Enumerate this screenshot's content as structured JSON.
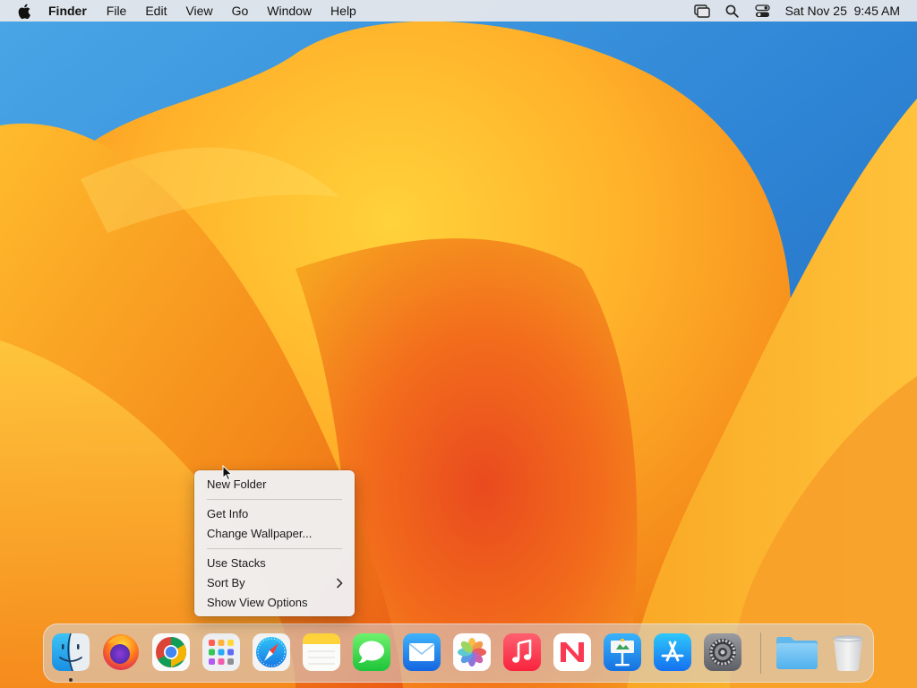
{
  "menubar": {
    "apple_icon": "apple-logo-icon",
    "app_name": "Finder",
    "menus": [
      "File",
      "Edit",
      "View",
      "Go",
      "Window",
      "Help"
    ],
    "status_icons": [
      "screen-mirroring-icon",
      "spotlight-search-icon",
      "control-center-icon"
    ],
    "clock": "Sat Nov 25  9:45 AM"
  },
  "context_menu": {
    "group1": [
      "New Folder"
    ],
    "group2": [
      "Get Info",
      "Change Wallpaper..."
    ],
    "group3": [
      "Use Stacks",
      "Sort By",
      "Show View Options"
    ],
    "submenu_icon": "chevron-right-icon"
  },
  "dock": {
    "apps": [
      {
        "name": "Finder",
        "icon": "finder-icon",
        "running": true
      },
      {
        "name": "Firefox",
        "icon": "firefox-icon"
      },
      {
        "name": "Google Chrome",
        "icon": "chrome-icon"
      },
      {
        "name": "Launchpad",
        "icon": "launchpad-icon"
      },
      {
        "name": "Safari",
        "icon": "safari-icon"
      },
      {
        "name": "Notes",
        "icon": "notes-icon"
      },
      {
        "name": "Messages",
        "icon": "messages-icon"
      },
      {
        "name": "Mail",
        "icon": "mail-icon"
      },
      {
        "name": "Photos",
        "icon": "photos-icon"
      },
      {
        "name": "Music",
        "icon": "music-icon"
      },
      {
        "name": "News",
        "icon": "news-icon"
      },
      {
        "name": "Keynote",
        "icon": "keynote-icon"
      },
      {
        "name": "App Store",
        "icon": "app-store-icon"
      },
      {
        "name": "System Settings",
        "icon": "system-settings-icon"
      }
    ],
    "others": [
      {
        "name": "Downloads",
        "icon": "folder-icon"
      },
      {
        "name": "Trash",
        "icon": "trash-icon"
      }
    ]
  },
  "colors": {
    "wallpaper_orange": "#f39a1e",
    "wallpaper_blue": "#2f7fd0",
    "menubar_bg": "#e8e8ec"
  }
}
